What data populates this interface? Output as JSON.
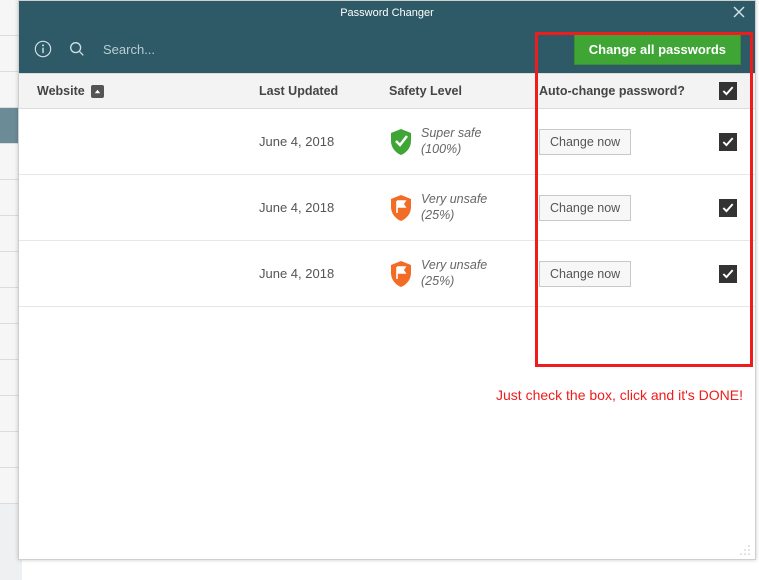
{
  "window": {
    "title": "Password Changer"
  },
  "toolbar": {
    "search_placeholder": "Search...",
    "change_all_label": "Change all passwords"
  },
  "columns": {
    "website": "Website",
    "last_updated": "Last Updated",
    "safety_level": "Safety Level",
    "auto_change": "Auto-change password?"
  },
  "header_checked": true,
  "rows": [
    {
      "website": "",
      "last_updated": "June 4, 2018",
      "safety_label": "Super safe",
      "safety_pct": "(100%)",
      "safety_color": "#3fa535",
      "safety_icon": "check",
      "action_label": "Change now",
      "checked": true
    },
    {
      "website": "",
      "last_updated": "June 4, 2018",
      "safety_label": "Very unsafe",
      "safety_pct": "(25%)",
      "safety_color": "#f26c26",
      "safety_icon": "flag",
      "action_label": "Change now",
      "checked": true
    },
    {
      "website": "",
      "last_updated": "June 4, 2018",
      "safety_label": "Very unsafe",
      "safety_pct": "(25%)",
      "safety_color": "#f26c26",
      "safety_icon": "flag",
      "action_label": "Change now",
      "checked": true
    }
  ],
  "annotation": {
    "text": "Just check the box, click and it's DONE!"
  }
}
